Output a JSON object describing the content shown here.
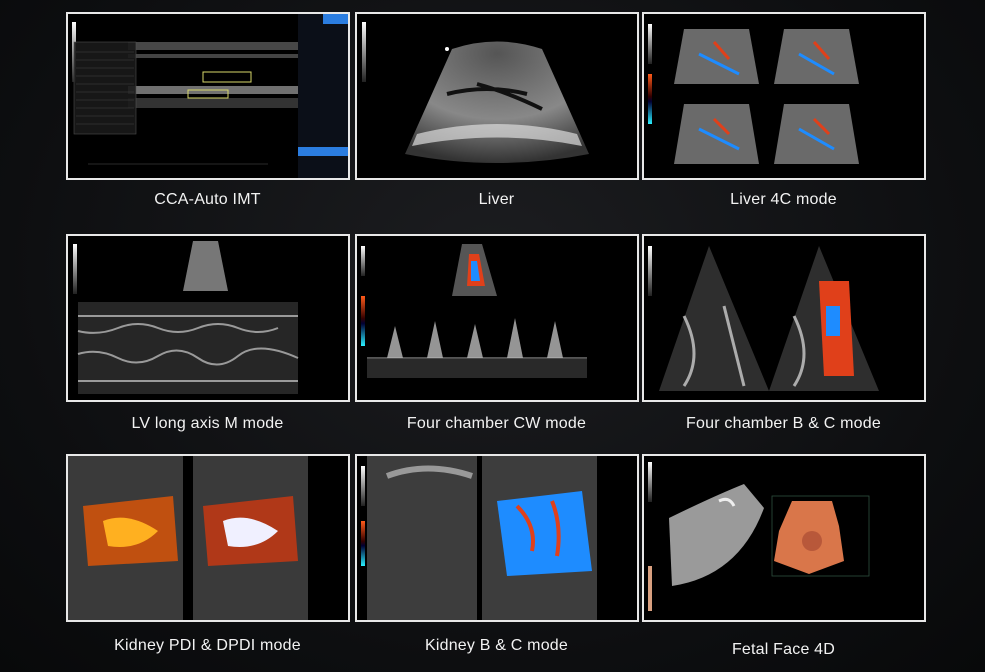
{
  "captions": [
    "CCA-Auto IMT",
    "Liver",
    "Liver 4C mode",
    "LV long axis M mode",
    "Four chamber CW mode",
    "Four chamber B & C mode",
    "Kidney PDI & DPDI mode",
    "Kidney B & C mode",
    "Fetal Face 4D"
  ],
  "colors": {
    "border": "#e8e8e8",
    "caption": "#f2f2f2",
    "menu_accent": "#2b7de0",
    "doppler_red": "#e0401a",
    "doppler_blue": "#1e8cff",
    "fetal_skin": "#d9764a"
  }
}
